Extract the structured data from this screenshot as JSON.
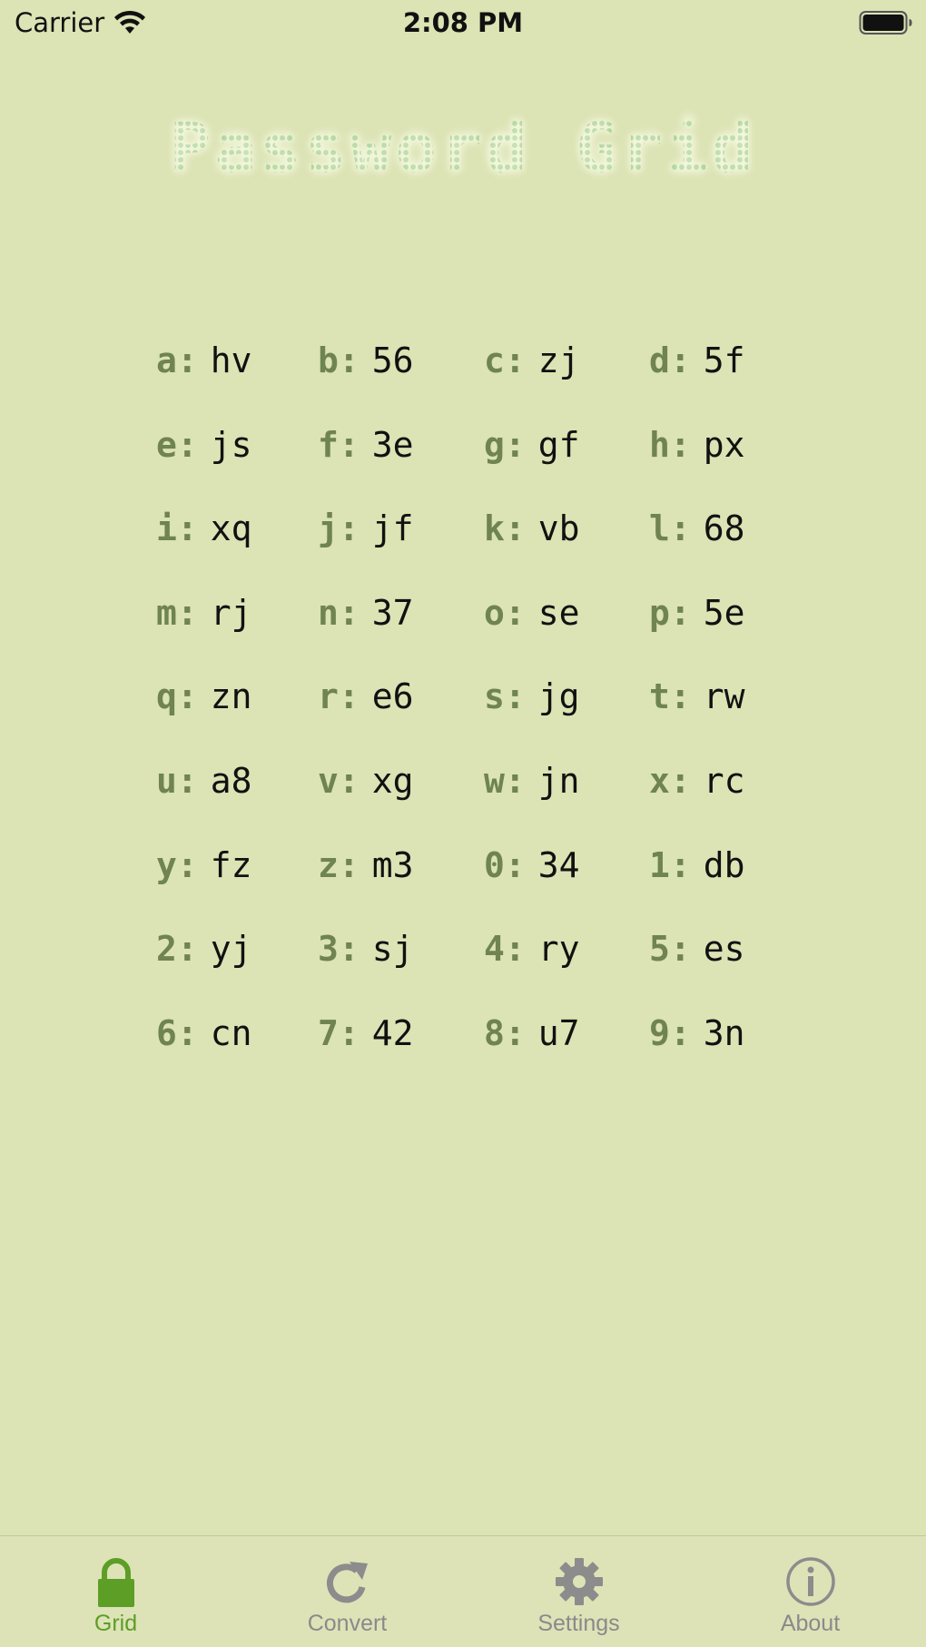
{
  "status_bar": {
    "carrier": "Carrier",
    "time": "2:08 PM"
  },
  "title": "Password Grid",
  "grid": [
    {
      "key": "a:",
      "value": "hv"
    },
    {
      "key": "b:",
      "value": "56"
    },
    {
      "key": "c:",
      "value": "zj"
    },
    {
      "key": "d:",
      "value": "5f"
    },
    {
      "key": "e:",
      "value": "js"
    },
    {
      "key": "f:",
      "value": "3e"
    },
    {
      "key": "g:",
      "value": "gf"
    },
    {
      "key": "h:",
      "value": "px"
    },
    {
      "key": "i:",
      "value": "xq"
    },
    {
      "key": "j:",
      "value": "jf"
    },
    {
      "key": "k:",
      "value": "vb"
    },
    {
      "key": "l:",
      "value": "68"
    },
    {
      "key": "m:",
      "value": "rj"
    },
    {
      "key": "n:",
      "value": "37"
    },
    {
      "key": "o:",
      "value": "se"
    },
    {
      "key": "p:",
      "value": "5e"
    },
    {
      "key": "q:",
      "value": "zn"
    },
    {
      "key": "r:",
      "value": "e6"
    },
    {
      "key": "s:",
      "value": "jg"
    },
    {
      "key": "t:",
      "value": "rw"
    },
    {
      "key": "u:",
      "value": "a8"
    },
    {
      "key": "v:",
      "value": "xg"
    },
    {
      "key": "w:",
      "value": "jn"
    },
    {
      "key": "x:",
      "value": "rc"
    },
    {
      "key": "y:",
      "value": "fz"
    },
    {
      "key": "z:",
      "value": "m3"
    },
    {
      "key": "0:",
      "value": "34"
    },
    {
      "key": "1:",
      "value": "db"
    },
    {
      "key": "2:",
      "value": "yj"
    },
    {
      "key": "3:",
      "value": "sj"
    },
    {
      "key": "4:",
      "value": "ry"
    },
    {
      "key": "5:",
      "value": "es"
    },
    {
      "key": "6:",
      "value": "cn"
    },
    {
      "key": "7:",
      "value": "42"
    },
    {
      "key": "8:",
      "value": "u7"
    },
    {
      "key": "9:",
      "value": "3n"
    }
  ],
  "tabs": [
    {
      "label": "Grid",
      "icon": "lock-icon",
      "active": true
    },
    {
      "label": "Convert",
      "icon": "redo-arrow-icon",
      "active": false
    },
    {
      "label": "Settings",
      "icon": "gear-icon",
      "active": false
    },
    {
      "label": "About",
      "icon": "info-icon",
      "active": false
    }
  ],
  "colors": {
    "background": "#dce3b4",
    "key_text": "#6f8450",
    "value_text": "#111111",
    "tab_active": "#5d9e26",
    "tab_inactive": "#8a8a8a",
    "title_dots": "#9ccc8a"
  }
}
